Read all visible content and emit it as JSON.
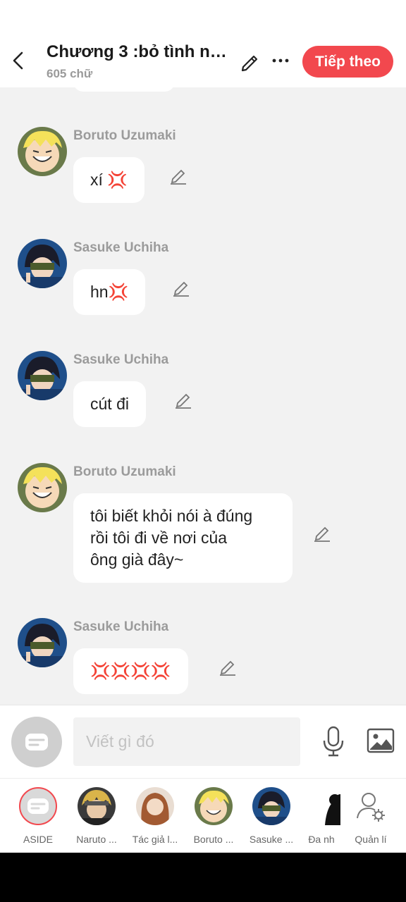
{
  "header": {
    "title": "Chương 3 :bỏ tình ng...",
    "word_count": "605 chữ",
    "next_label": "Tiếp theo"
  },
  "messages": [
    {
      "name": "Boruto Uzumaki",
      "text": "xí 💢",
      "avatar": "boruto"
    },
    {
      "name": "Sasuke Uchiha",
      "text": "hn💢",
      "avatar": "sasuke"
    },
    {
      "name": "Sasuke Uchiha",
      "text": "cút đi",
      "avatar": "sasuke"
    },
    {
      "name": "Boruto Uzumaki",
      "text": "tôi biết khỏi nói à đúng\nrồi tôi đi về nơi của\nông già đây~",
      "avatar": "boruto"
    },
    {
      "name": "Sasuke Uchiha",
      "text": "💢💢💢💢",
      "avatar": "sasuke"
    }
  ],
  "input": {
    "placeholder": "Viết gì đó"
  },
  "characters": [
    {
      "label": "ASIDE"
    },
    {
      "label": "Naruto ..."
    },
    {
      "label": "Tác giả l..."
    },
    {
      "label": "Boruto ..."
    },
    {
      "label": "Sasuke ..."
    },
    {
      "label": "Đa nh"
    },
    {
      "label": "Quản lí"
    }
  ],
  "colors": {
    "accent": "#f2484e",
    "background": "#f2f2f2"
  }
}
